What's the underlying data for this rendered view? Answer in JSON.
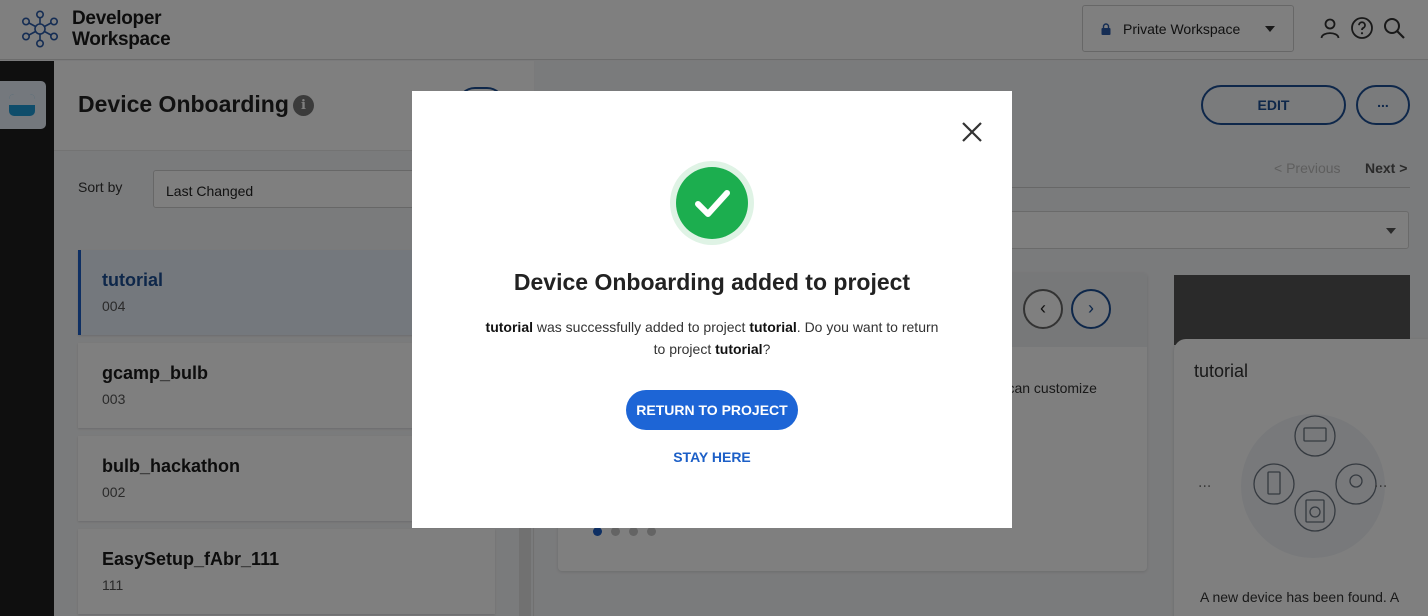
{
  "header": {
    "logo_line1": "Developer",
    "logo_line2": "Workspace",
    "workspace_label": "Private Workspace",
    "icons": [
      "user-icon",
      "help-icon",
      "search-icon"
    ]
  },
  "list": {
    "title": "Device Onboarding",
    "sort_label": "Sort by",
    "sort_value": "Last Changed",
    "items": [
      {
        "name": "tutorial",
        "number": "004",
        "selected": true
      },
      {
        "name": "gcamp_bulb",
        "number": "003"
      },
      {
        "name": "bulb_hackathon",
        "number": "002"
      },
      {
        "name": "EasySetup_fAbr_111",
        "number": "111"
      }
    ]
  },
  "detail": {
    "edit_label": "EDIT",
    "more_label": "...",
    "prev_label": "< Previous",
    "next_label": "Next >",
    "carousel_text": "ou can customize",
    "side_title": "tutorial",
    "side_desc": "A new device has been found. A"
  },
  "dialog": {
    "title": "Device Onboarding added to project",
    "msg_name": "tutorial",
    "msg_part1": " was successfully added to project ",
    "msg_project": "tutorial",
    "msg_part2": ". Do you want to return to project ",
    "msg_project2": "tutorial",
    "msg_part3": "?",
    "primary_label": "RETURN TO PROJECT",
    "secondary_label": "STAY HERE"
  },
  "colors": {
    "accent": "#1d65d6",
    "success": "#1cae4f",
    "overlay": "rgba(0,0,0,0.5)"
  }
}
